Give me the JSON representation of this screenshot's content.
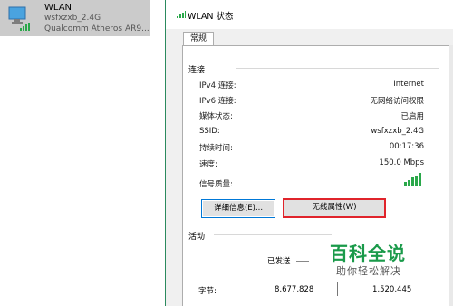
{
  "network_tile": {
    "name": "WLAN",
    "ssid": "wsfxzxb_2.4G",
    "adapter": "Qualcomm Atheros AR9..."
  },
  "dialog": {
    "title": "WLAN 状态",
    "tab": "常规",
    "connection_group": "连接",
    "rows": [
      {
        "label": "IPv4 连接:",
        "value": "Internet"
      },
      {
        "label": "IPv6 连接:",
        "value": "无网络访问权限"
      },
      {
        "label": "媒体状态:",
        "value": "已启用"
      },
      {
        "label": "SSID:",
        "value": "wsfxzxb_2.4G"
      },
      {
        "label": "持续时间:",
        "value": "00:17:36"
      },
      {
        "label": "速度:",
        "value": "150.0 Mbps"
      }
    ],
    "signal_label": "信号质量:",
    "signal_bars": 5,
    "details_button": "详细信息(E)...",
    "wireless_props_button": "无线属性(W)",
    "activity_group": "活动",
    "sent_label": "已发送",
    "bytes_label": "字节:",
    "bytes_sent": "8,677,828",
    "bytes_received": "1,520,445"
  },
  "watermark": {
    "brand": "百科全说",
    "slogan": "助你轻松解决"
  },
  "colors": {
    "signal": "#2aa84a",
    "highlight_border": "#e0242b",
    "watermark": "#1a9a4a",
    "primary_button_border": "#0078d7"
  }
}
